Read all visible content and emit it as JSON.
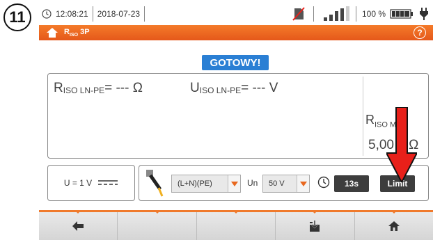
{
  "step_badge": "11",
  "status": {
    "time": "12:08:21",
    "date": "2018-07-23",
    "battery_percent": "100 %",
    "signal_level": 4
  },
  "header": {
    "title_main": "R",
    "title_sub": "ISO",
    "title_suffix": "3P",
    "help": "?"
  },
  "ready_label": "GOTOWY!",
  "result": {
    "r_symbol": "R",
    "r_sub": "ISO LN-PE",
    "r_value": "= --- Ω",
    "u_symbol": "U",
    "u_sub": "ISO LN-PE",
    "u_value": "= --- V",
    "limit_symbol": "R",
    "limit_sub": "ISO MIN",
    "limit_value": "5,00 MΩ"
  },
  "voltage": {
    "label": "U = 1 V"
  },
  "controls": {
    "probe_select": "(L+N)(PE)",
    "un_label": "Un",
    "un_select": "50 V",
    "time_button": "13s",
    "limit_button": "Limit"
  },
  "colors": {
    "accent": "#f07a2c",
    "ready_badge": "#2a7fd4",
    "arrow": "#e8201a"
  },
  "nav": [
    "back-icon",
    "",
    "",
    "save-icon",
    "home-icon"
  ]
}
